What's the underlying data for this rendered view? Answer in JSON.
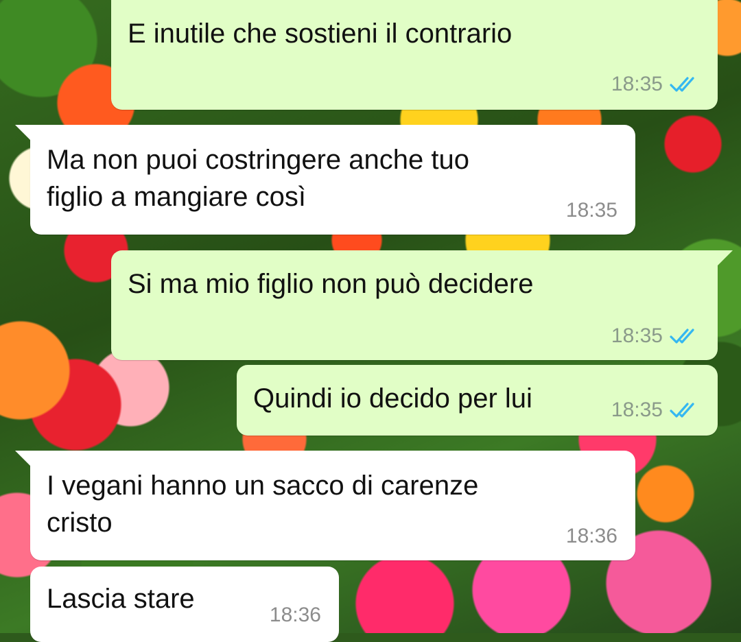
{
  "chat": {
    "messages": [
      {
        "direction": "outgoing",
        "text": "E inutile che sostieni il contrario",
        "time": "18:35",
        "status": "read"
      },
      {
        "direction": "incoming",
        "text": "Ma non puoi costringere anche tuo\nfiglio a mangiare così",
        "time": "18:35"
      },
      {
        "direction": "outgoing",
        "text": "Si ma mio figlio non può decidere",
        "time": "18:35",
        "status": "read"
      },
      {
        "direction": "outgoing",
        "text": "Quindi io decido per lui",
        "time": "18:35",
        "status": "read"
      },
      {
        "direction": "incoming",
        "text": "I vegani hanno un sacco di carenze\ncristo",
        "time": "18:36"
      },
      {
        "direction": "incoming",
        "text": "Lascia stare",
        "time": "18:36"
      }
    ]
  },
  "colors": {
    "outgoing_bubble": "#e1fec6",
    "incoming_bubble": "#ffffff",
    "read_ticks": "#34b7f1"
  },
  "icons": {
    "read_status": "double-check-icon",
    "wallpaper": "flower-wallpaper"
  }
}
